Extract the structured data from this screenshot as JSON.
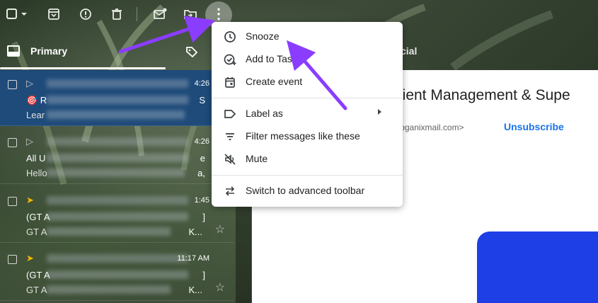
{
  "toolbar": {
    "icons": [
      "select-checkbox",
      "select-dropdown-chevron",
      "archive",
      "report-spam",
      "delete",
      "mark-unread",
      "move-to",
      "more-options"
    ],
    "more_glyph": "⋮"
  },
  "tabs": {
    "primary": "Primary",
    "social": "cial"
  },
  "emails": [
    {
      "time": "4:26",
      "subject": "🎯 R",
      "subject_trail": "S",
      "snippet": "Lear",
      "selected": true,
      "important": false
    },
    {
      "time": "4:26",
      "subject": "All U",
      "subject_trail": "e",
      "snippet": "Hello",
      "snippet_trail": "a,",
      "selected": false,
      "important": false
    },
    {
      "time": "1:45",
      "subject": "(GT A",
      "subject_trail": "]",
      "snippet": "GT A",
      "snippet_trail": "K...",
      "selected": false,
      "important": true
    },
    {
      "time": "11:17 AM",
      "subject": "(GT A",
      "subject_trail": "]",
      "snippet": "GT A",
      "snippet_trail": "K...",
      "selected": false,
      "important": true
    }
  ],
  "reading_pane": {
    "title": "r Client Management & Supe",
    "email_fragment": "ron@loganixmail.com>",
    "unsubscribe": "Unsubscribe",
    "accent_color": "#1f3fe6"
  },
  "menu": {
    "items": [
      {
        "label": "Snooze",
        "icon": "clock-icon"
      },
      {
        "label": "Add to Tasks",
        "icon": "add-task-icon"
      },
      {
        "label": "Create event",
        "icon": "calendar-event-icon"
      },
      {
        "label": "Label as",
        "icon": "label-icon",
        "submenu": true
      },
      {
        "label": "Filter messages like these",
        "icon": "filter-icon"
      },
      {
        "label": "Mute",
        "icon": "mute-icon"
      },
      {
        "label": "Switch to advanced toolbar",
        "icon": "switch-arrows-icon"
      }
    ]
  },
  "annotation": {
    "arrow_color": "#8b3dff"
  }
}
